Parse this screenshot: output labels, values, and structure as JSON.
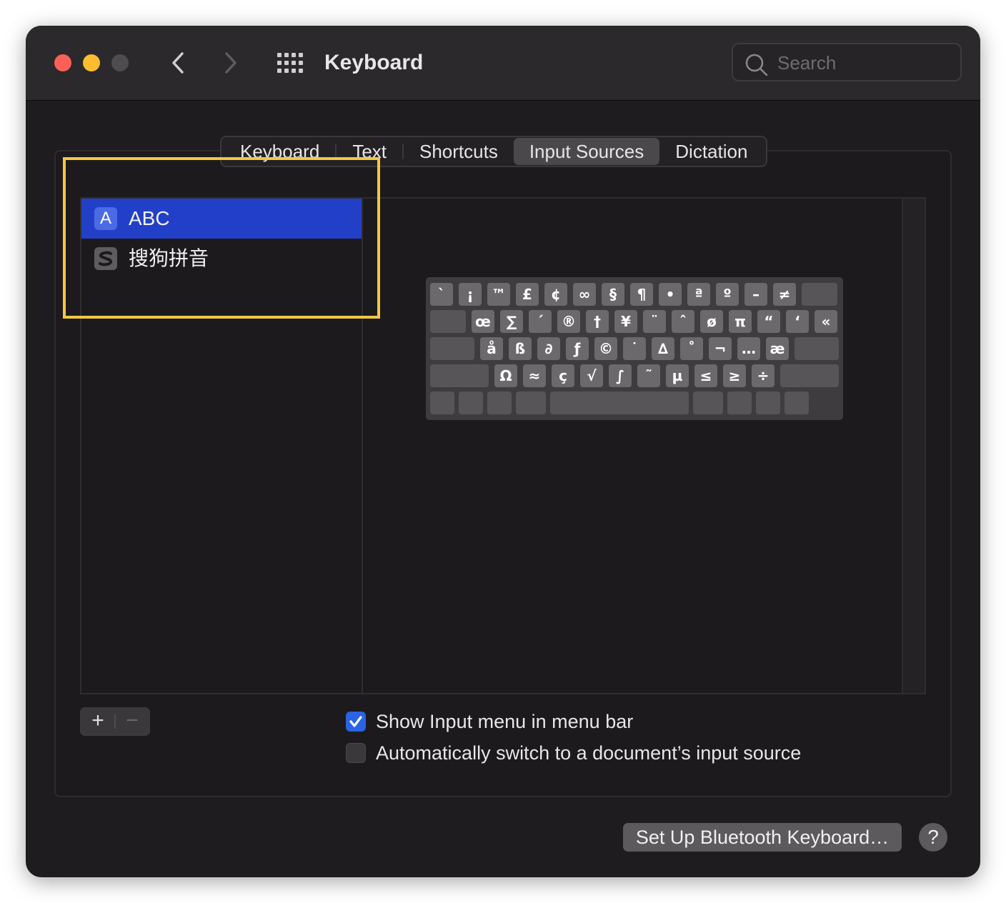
{
  "window": {
    "title": "Keyboard",
    "search_placeholder": "Search"
  },
  "tabs": [
    {
      "label": "Keyboard"
    },
    {
      "label": "Text"
    },
    {
      "label": "Shortcuts"
    },
    {
      "label": "Input Sources",
      "active": true
    },
    {
      "label": "Dictation"
    }
  ],
  "input_sources": [
    {
      "label": "ABC",
      "icon": "A",
      "selected": true
    },
    {
      "label": "搜狗拼音",
      "icon": "S",
      "selected": false
    }
  ],
  "keyboard_rows": [
    [
      "`",
      "¡",
      "™",
      "£",
      "¢",
      "∞",
      "§",
      "¶",
      "•",
      "ª",
      "º",
      "–",
      "≠",
      ""
    ],
    [
      "",
      "œ",
      "∑",
      "´",
      "®",
      "†",
      "¥",
      "¨",
      "ˆ",
      "ø",
      "π",
      "“",
      "‘",
      "«"
    ],
    [
      "",
      "å",
      "ß",
      "∂",
      "ƒ",
      "©",
      "˙",
      "∆",
      "˚",
      "¬",
      "…",
      "æ",
      ""
    ],
    [
      "",
      "Ω",
      "≈",
      "ç",
      "√",
      "∫",
      "˜",
      "µ",
      "≤",
      "≥",
      "÷",
      ""
    ],
    [
      "",
      "",
      "",
      "",
      "",
      "",
      "",
      "",
      ""
    ]
  ],
  "buttons": {
    "add": "+",
    "remove": "−",
    "bluetooth": "Set Up Bluetooth Keyboard…",
    "help": "?"
  },
  "options": {
    "show_input_menu": "Show Input menu in menu bar",
    "show_input_menu_checked": true,
    "auto_switch": "Automatically switch to a document’s input source",
    "auto_switch_checked": false
  },
  "colors": {
    "selection": "#2240c7",
    "checkbox_on": "#2a63e4",
    "highlight": "#f2c744"
  }
}
